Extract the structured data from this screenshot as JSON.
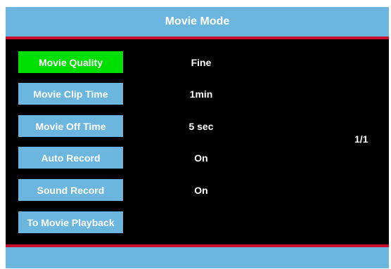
{
  "header": {
    "title": "Movie Mode"
  },
  "menu": {
    "items": [
      {
        "label": "Movie Quality",
        "value": "Fine",
        "selected": true
      },
      {
        "label": "Movie Clip Time",
        "value": "1min",
        "selected": false
      },
      {
        "label": "Movie Off Time",
        "value": "5 sec",
        "selected": false
      },
      {
        "label": "Auto Record",
        "value": "On",
        "selected": false
      },
      {
        "label": "Sound Record",
        "value": "On",
        "selected": false
      },
      {
        "label": "To Movie Playback",
        "value": "",
        "selected": false
      }
    ]
  },
  "page_indicator": "1/1",
  "colors": {
    "header_bg": "#6ab6df",
    "accent_red": "#c8102e",
    "button_bg": "#6ab6df",
    "selected_bg": "#00e000",
    "screen_bg": "#000000",
    "text": "#ffffff"
  }
}
